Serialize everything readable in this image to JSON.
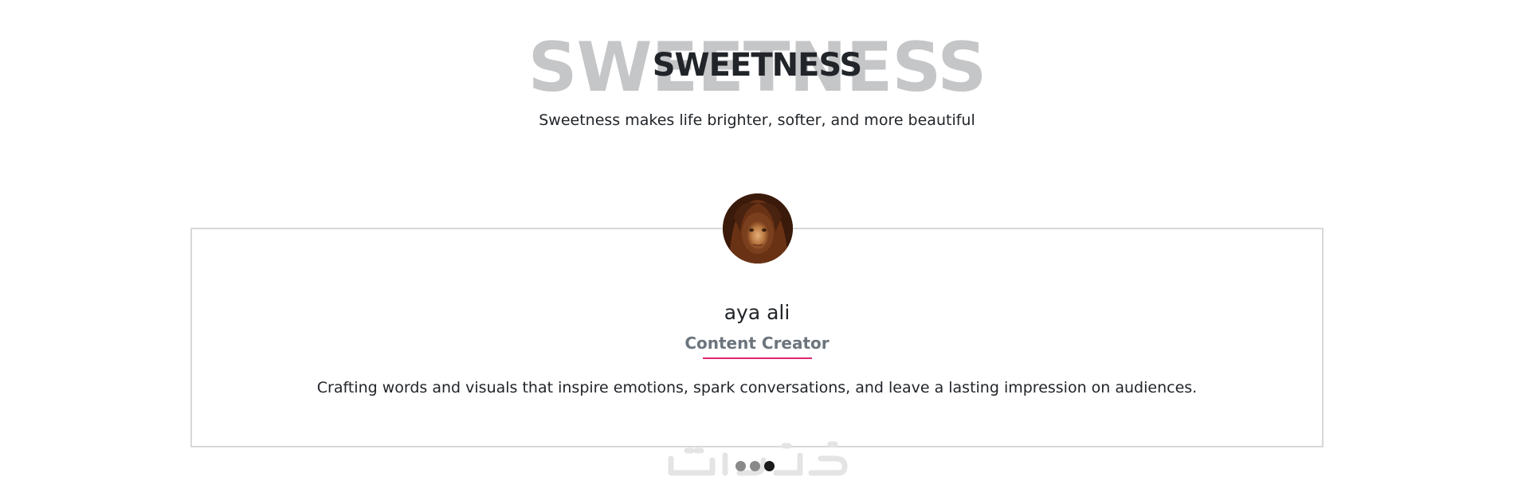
{
  "section": {
    "background_title": "SWEETNESS",
    "title": "SWEETNESS",
    "subtitle": "Sweetness makes life brighter, softer, and more beautiful"
  },
  "testimonial": {
    "avatar": "person-photo",
    "name": "aya ali",
    "role": "Content Creator",
    "description": "Crafting words and visuals that inspire emotions, spark conversations, and leave a lasting impression on audiences."
  },
  "carousel": {
    "indicators": [
      {
        "active": false
      },
      {
        "active": false
      },
      {
        "active": true
      }
    ]
  },
  "watermark": {
    "text": "خمسات"
  },
  "colors": {
    "accent": "#e0246e",
    "bg_title": "#c5c6c8",
    "text": "#212529",
    "muted": "#6c757d",
    "card_border": "#d8d8d8",
    "dot_inactive": "#8a8a8a",
    "dot_active": "#1a1a1a"
  }
}
